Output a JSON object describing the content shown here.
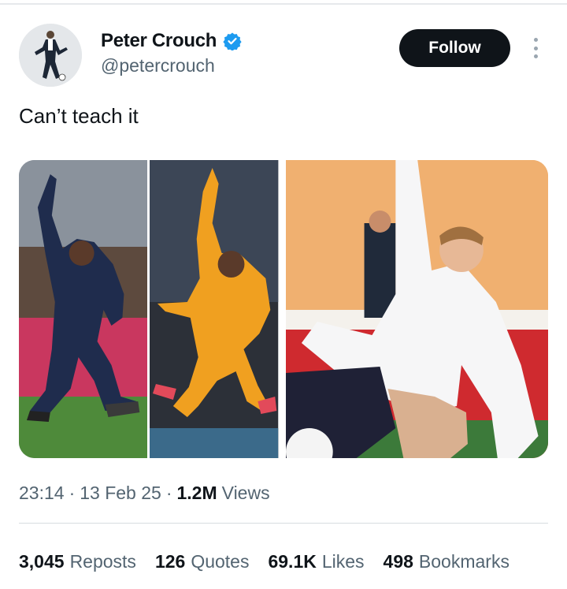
{
  "tweet": {
    "author_name": "Peter Crouch",
    "author_handle": "@petercrouch",
    "follow_label": "Follow",
    "text": "Can’t teach it",
    "time": "23:14",
    "separator": "·",
    "date": "13 Feb 25",
    "views_count": "1.2M",
    "views_label": "Views"
  },
  "stats": [
    {
      "num": "3,045",
      "label": "Reposts"
    },
    {
      "num": "126",
      "label": "Quotes"
    },
    {
      "num": "69.1K",
      "label": "Likes"
    },
    {
      "num": "498",
      "label": "Bookmarks"
    }
  ],
  "media": {
    "photos": [
      "photo-kylian-mbappe-france",
      "photo-kylian-mbappe-orange",
      "photo-peter-crouch-england"
    ]
  },
  "colors": {
    "accent": "#1d9bf0",
    "follow_bg": "#0f1419",
    "secondary_text": "#536471"
  }
}
